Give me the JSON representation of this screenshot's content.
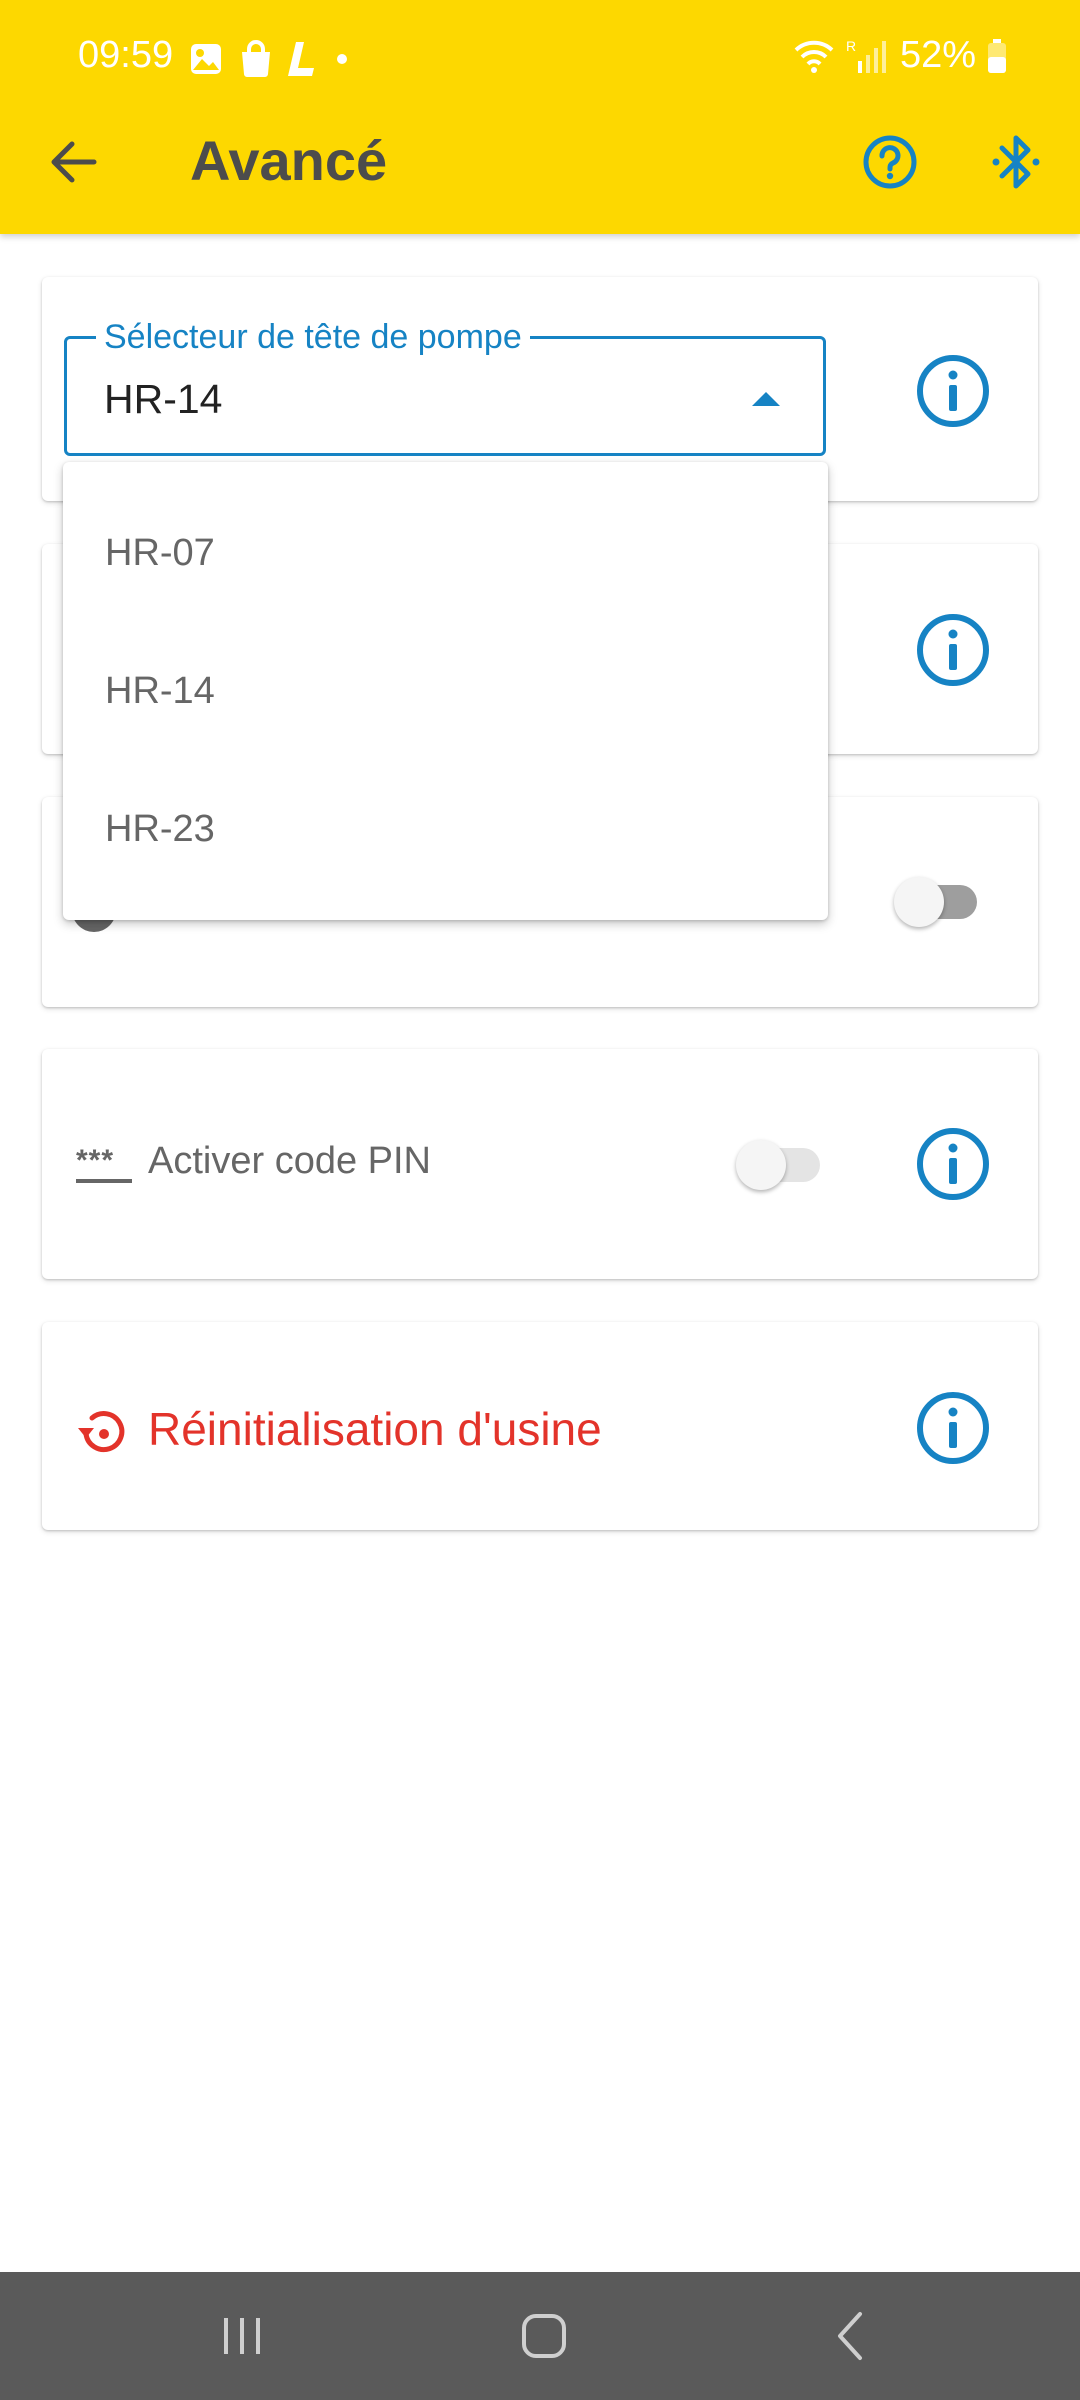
{
  "status_bar": {
    "time": "09:59",
    "battery": "52%",
    "roaming_indicator": "R",
    "icons": [
      "gallery-icon",
      "shopping-bag-icon",
      "l-app-icon",
      "dot-icon",
      "wifi-icon",
      "signal-icon",
      "battery-icon"
    ]
  },
  "header": {
    "title": "Avancé",
    "back_icon": "arrow-left-icon",
    "help_icon": "help-circle-icon",
    "bluetooth_icon": "bluetooth-icon"
  },
  "pump_head_select": {
    "label": "Sélecteur de tête de pompe",
    "value": "HR-14",
    "expanded": true,
    "options": [
      "HR-07",
      "HR-14",
      "HR-23"
    ]
  },
  "settings": {
    "hidden_toggle": {
      "enabled": false
    },
    "pin": {
      "label": "Activer code PIN",
      "icon": "***",
      "enabled": false
    },
    "factory_reset": {
      "label": "Réinitialisation d'usine",
      "icon": "restore-icon"
    }
  },
  "colors": {
    "header_bg": "#FDD800",
    "accent_blue": "#1683c4",
    "danger_red": "#e3332a",
    "nav_bar": "#5a5a5a"
  },
  "nav_bar": {
    "icons": [
      "recent-apps-icon",
      "home-icon",
      "back-icon"
    ]
  }
}
